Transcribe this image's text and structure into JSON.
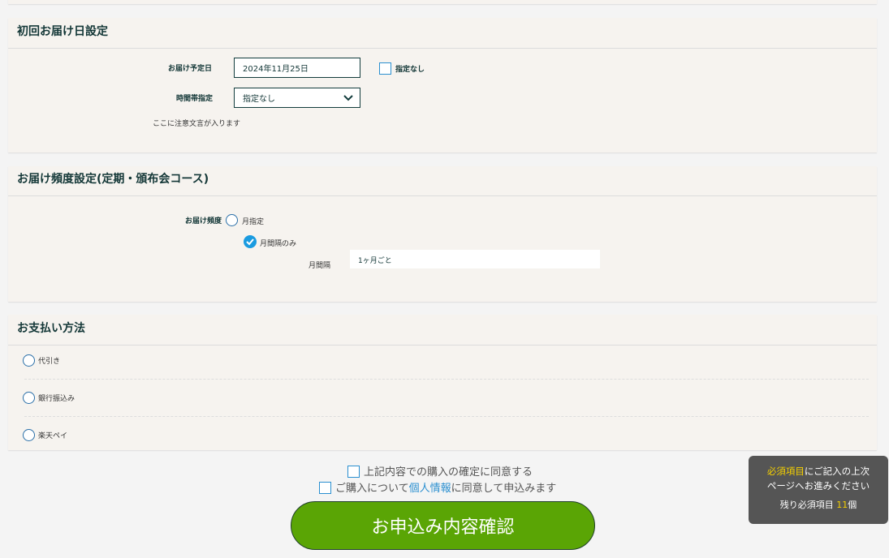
{
  "delivery_date": {
    "title": "初回お届け日設定",
    "date_label": "お届け予定日",
    "date_value": "2024年11月25日",
    "no_date_label": "指定なし",
    "time_label": "時間帯指定",
    "time_value": "指定なし",
    "note": "ここに注意文言が入ります"
  },
  "frequency": {
    "title": "お届け頻度設定(定期・頒布会コース)",
    "label": "お届け頻度",
    "option_month": "月指定",
    "option_interval": "月間隔のみ",
    "interval_label": "月間隔",
    "interval_value": "1ヶ月ごと"
  },
  "payment": {
    "title": "お支払い方法",
    "options": [
      "代引き",
      "銀行振込み",
      "楽天ペイ"
    ]
  },
  "agree": {
    "confirm": "上記内容での購入の確定に同意する",
    "privacy_pre": "ご購入について",
    "privacy_link": "個人情報",
    "privacy_post": "に同意して申込みます"
  },
  "submit_label": "お申込み内容確認",
  "tooltip": {
    "highlight": "必須項目",
    "line1_rest": "にご記入の上次",
    "line2": "ページへお進みください",
    "remaining_pre": "残り必須項目 ",
    "remaining_count": "11",
    "remaining_post": "個"
  },
  "colors": {
    "accent": "#5aa505",
    "link": "#2a8fd0",
    "highlight": "#f5d000"
  }
}
